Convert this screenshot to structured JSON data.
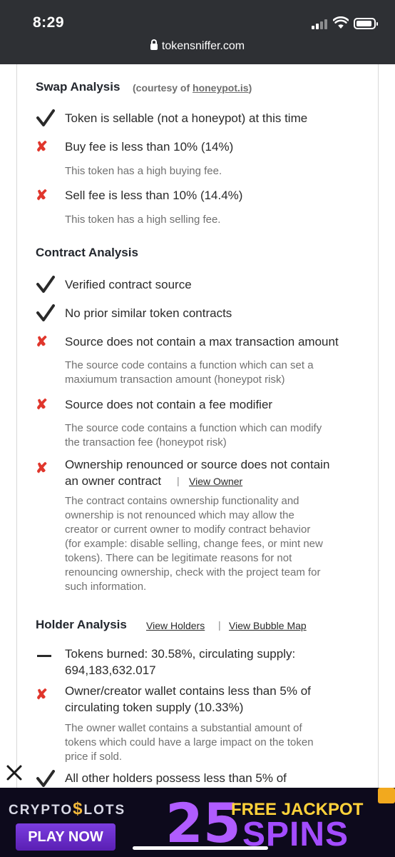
{
  "status": {
    "time": "8:29",
    "url": "tokensniffer.com"
  },
  "swap": {
    "heading": "Swap Analysis",
    "courtesy_prefix": "(courtesy of ",
    "courtesy_link": "honeypot.is",
    "courtesy_suffix": ")",
    "items": [
      {
        "status": "pass",
        "text": "Token is sellable (not a honeypot) at this time"
      },
      {
        "status": "fail",
        "text": "Buy fee is less than 10% (14%)",
        "note": "This token has a high buying fee."
      },
      {
        "status": "fail",
        "text": "Sell fee is less than 10% (14.4%)",
        "note": "This token has a high selling fee."
      }
    ]
  },
  "contract": {
    "heading": "Contract Analysis",
    "items": [
      {
        "status": "pass",
        "text": "Verified contract source"
      },
      {
        "status": "pass",
        "text": "No prior similar token contracts"
      },
      {
        "status": "fail",
        "text": "Source does not contain a max transaction amount",
        "note_lines": [
          "The source code contains a function which can set a",
          "maxiumum transaction amount (honeypot risk)"
        ]
      },
      {
        "status": "fail",
        "text": "Source does not contain a fee modifier",
        "note_lines": [
          "The source code contains a function which can modify",
          "the transaction fee (honeypot risk)"
        ]
      },
      {
        "status": "fail",
        "text_lines": [
          "Ownership renounced or source does not contain",
          "an owner contract"
        ],
        "link": "View Owner",
        "note_lines": [
          "The contract contains ownership functionality and",
          "ownership is not renounced which may allow the",
          "creator or current owner to modify contract behavior",
          "(for example: disable selling, change fees, or mint new",
          "tokens).  There can be legitimate reasons for not",
          "renouncing ownership, check with the project team for",
          "such information."
        ]
      }
    ]
  },
  "holder": {
    "heading": "Holder Analysis",
    "link_holders": "View Holders",
    "link_bubble": "View Bubble Map",
    "separator": "|",
    "items": [
      {
        "status": "neutral",
        "text_lines": [
          "Tokens burned: 30.58%, circulating supply:",
          "694,183,632.017"
        ]
      },
      {
        "status": "fail",
        "text_lines": [
          "Owner/creator wallet contains less than 5% of",
          "circulating token supply (10.33%)"
        ],
        "note_lines": [
          "The owner wallet contains a substantial amount of",
          "tokens which could have a large impact on the token",
          "price if sold."
        ]
      },
      {
        "status": "pass",
        "text": "All other holders possess less than 5% of"
      }
    ]
  },
  "ad": {
    "logo_left": "CRYPTO",
    "logo_dollar": "$",
    "logo_right": "LOTS",
    "button": "PLAY NOW",
    "number": "25",
    "free": "FREE JACKPOT",
    "spins": "SPINS"
  },
  "colors": {
    "fail": "#e0362c",
    "pass": "#2a2a2a",
    "ad_purple": "#a34cff",
    "ad_gold": "#ffd23a"
  }
}
